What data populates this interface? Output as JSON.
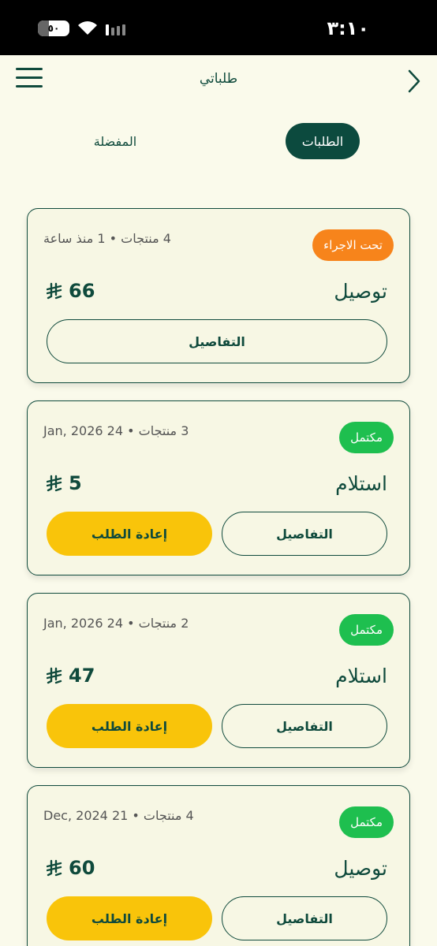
{
  "status_bar": {
    "time": "٣:١٠",
    "battery": "٥٠"
  },
  "header": {
    "title": "طلباتي"
  },
  "tabs": {
    "active": "الطلبات",
    "inactive": "المفضلة"
  },
  "colors": {
    "primary": "#0F4A3C",
    "background": "#FAFAEB",
    "in_progress": "#F7841B",
    "completed": "#1EBF4F",
    "reorder": "#F9C40A"
  },
  "orders": [
    {
      "status": "تحت الاجراء",
      "meta": "4 منتجات • 1 منذ ساعة",
      "type": "توصيل",
      "price": "66",
      "details_label": "التفاصيل"
    },
    {
      "status": "مكتمل",
      "meta": "3 منتجات • 24 Jan, 2026",
      "type": "استلام",
      "price": "5",
      "details_label": "التفاصيل",
      "reorder_label": "إعادة الطلب"
    },
    {
      "status": "مكتمل",
      "meta": "2 منتجات • 24 Jan, 2026",
      "type": "استلام",
      "price": "47",
      "details_label": "التفاصيل",
      "reorder_label": "إعادة الطلب"
    },
    {
      "status": "مكتمل",
      "meta": "4 منتجات • 21 Dec, 2024",
      "type": "توصيل",
      "price": "60",
      "details_label": "التفاصيل",
      "reorder_label": "إعادة الطلب"
    }
  ]
}
